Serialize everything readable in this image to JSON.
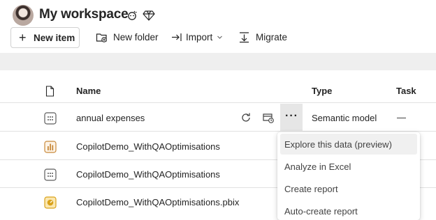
{
  "workspace": {
    "title": "My workspace"
  },
  "toolbar": {
    "new_item": "New item",
    "new_folder": "New folder",
    "import": "Import",
    "migrate": "Migrate"
  },
  "table": {
    "columns": {
      "name": "Name",
      "type": "Type",
      "task": "Task"
    },
    "rows": [
      {
        "name": "annual expenses",
        "type": "Semantic model",
        "task": "—",
        "icon": "semantic-model-icon"
      },
      {
        "name": "CopilotDemo_WithQAOptimisations",
        "type": "",
        "task": "",
        "icon": "report-icon"
      },
      {
        "name": "CopilotDemo_WithQAOptimisations",
        "type": "",
        "task": "",
        "icon": "semantic-model-icon"
      },
      {
        "name": "CopilotDemo_WithQAOptimisations.pbix",
        "type": "",
        "task": "",
        "icon": "dashboard-icon"
      }
    ]
  },
  "context_menu": {
    "items": [
      "Explore this data (preview)",
      "Analyze in Excel",
      "Create report",
      "Auto-create report"
    ]
  },
  "colors": {
    "accent_report": "#c8893a",
    "accent_dashboard": "#d9a21b",
    "semantic_model_icon": "#5b5b5b",
    "band": "#efefef"
  }
}
